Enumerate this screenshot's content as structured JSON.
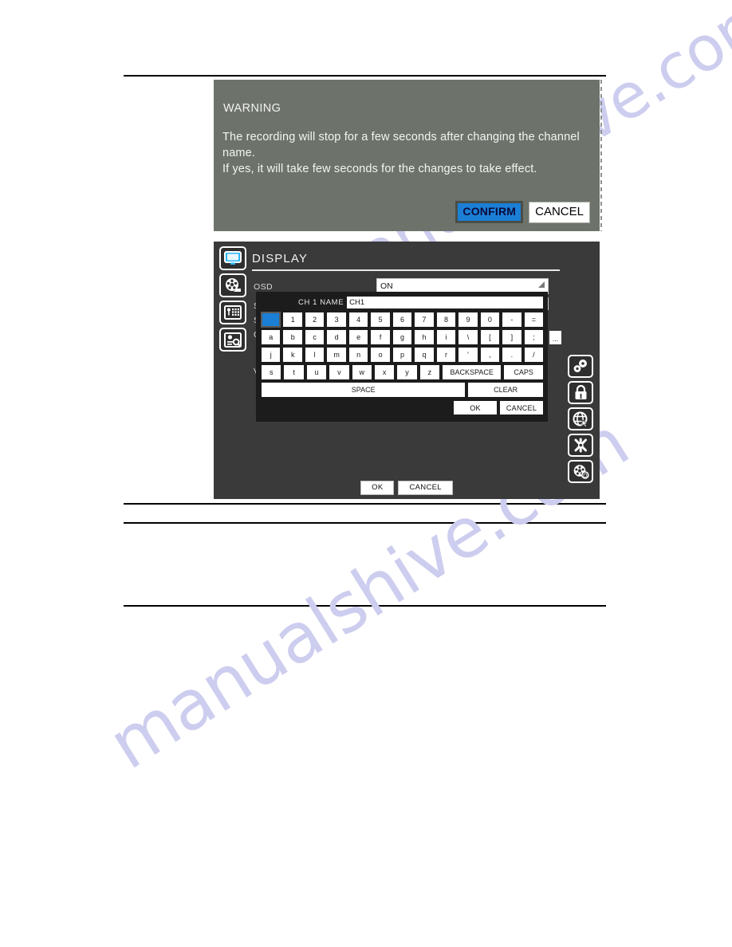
{
  "warning_dialog": {
    "title": "WARNING",
    "body_line1": "The recording will stop for a few seconds after changing the channel name.",
    "body_line2": "If yes, it will take few seconds for the changes  to take effect.",
    "confirm_label": "CONFIRM",
    "cancel_label": "CANCEL",
    "background_color": "#6d736b",
    "confirm_color": "#1b7fd6"
  },
  "dvr_panel": {
    "title": "DISPLAY",
    "left_rail": [
      {
        "name": "monitor-icon",
        "label": "DISPLAY",
        "active": true
      },
      {
        "name": "film-reel-icon",
        "label": "RECORD",
        "active": false
      },
      {
        "name": "safe-keypad-icon",
        "label": "DEVICE",
        "active": false
      },
      {
        "name": "document-search-icon",
        "label": "SEARCH",
        "active": false
      }
    ],
    "right_rail": [
      {
        "name": "gears-icon",
        "label": "SYSTEM"
      },
      {
        "name": "padlock-icon",
        "label": "SECURITY"
      },
      {
        "name": "globe-cursor-icon",
        "label": "NETWORK"
      },
      {
        "name": "wrench-tools-icon",
        "label": "MAINTENANCE"
      },
      {
        "name": "film-reel-q-icon",
        "label": "BACKUP"
      }
    ],
    "form": {
      "osd_label": "OSD",
      "osd_value": "ON",
      "row2_label": "S",
      "row3_label": "S",
      "row4_label": "C",
      "row5_label": "V"
    },
    "ok_label": "OK",
    "cancel_label": "CANCEL"
  },
  "keyboard": {
    "name_label": "CH 1 NAME",
    "name_value": "CH1",
    "rows": [
      [
        "`",
        "1",
        "2",
        "3",
        "4",
        "5",
        "6",
        "7",
        "8",
        "9",
        "0",
        "-",
        "="
      ],
      [
        "a",
        "b",
        "c",
        "d",
        "e",
        "f",
        "g",
        "h",
        "i",
        "\\",
        "[",
        "]",
        ";"
      ],
      [
        "j",
        "k",
        "l",
        "m",
        "n",
        "o",
        "p",
        "q",
        "r",
        "'",
        ",",
        ".",
        "/"
      ],
      [
        "s",
        "t",
        "u",
        "v",
        "w",
        "x",
        "y",
        "z"
      ]
    ],
    "selected_key": "`",
    "backspace_label": "BACKSPACE",
    "caps_label": "CAPS",
    "space_label": "SPACE",
    "clear_label": "CLEAR",
    "ok_label": "OK",
    "cancel_label": "CANCEL",
    "ellipsis_label": "..."
  },
  "watermark": {
    "upper": "manualshive.com",
    "lower": "manualshive.com",
    "color": "#cdcdef"
  }
}
